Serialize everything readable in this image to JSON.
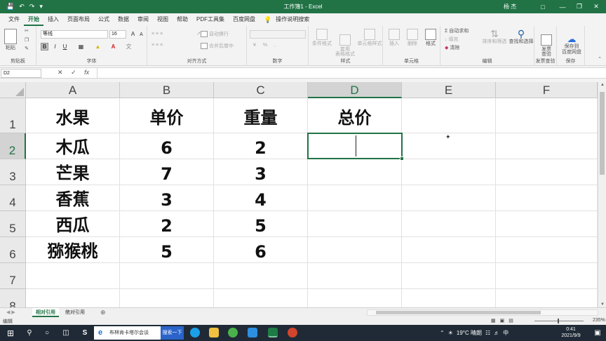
{
  "window": {
    "title": "工作簿1 - Excel",
    "user": "杨 杰",
    "controls": [
      "restore-ribbon",
      "minimize",
      "maximize",
      "close"
    ]
  },
  "quick_access": {
    "save": "save-icon",
    "undo": "undo-icon",
    "redo": "redo-icon",
    "customize": "customize-icon"
  },
  "tabs": [
    "文件",
    "开始",
    "插入",
    "页面布局",
    "公式",
    "数据",
    "审阅",
    "视图",
    "帮助",
    "PDF工具集",
    "百度网盘",
    "操作说明搜索"
  ],
  "active_tab": "开始",
  "ribbon": {
    "clipboard": {
      "paste": "粘贴",
      "label": "剪贴板"
    },
    "font": {
      "name": "等线",
      "size": "16",
      "bold": "B",
      "italic": "I",
      "underline": "U",
      "label": "字体",
      "grow": "A",
      "shrink": "A"
    },
    "alignment": {
      "wrap": "自动换行",
      "merge": "合并后居中",
      "label": "对齐方式"
    },
    "number": {
      "label": "数字",
      "percent": "%",
      "comma": ","
    },
    "styles": {
      "conditional": "条件格式",
      "table": "套用\n表格格式",
      "cell": "单元格样式",
      "label": "样式"
    },
    "cells": {
      "insert": "插入",
      "delete": "删除",
      "format": "格式",
      "label": "单元格"
    },
    "editing": {
      "autosum": "自动求和",
      "fill": "填充",
      "clear": "清除",
      "sort": "排序和筛选",
      "find": "查找和选择",
      "label": "编辑"
    },
    "invoice": {
      "button": "发票\n查验",
      "label": "发票查验"
    },
    "save_group": {
      "button": "保存到\n百度网盘",
      "label": "保存"
    }
  },
  "formula_bar": {
    "name_box": "D2",
    "value": "",
    "cancel": "✕",
    "enter": "✓",
    "fx": "fx"
  },
  "columns": [
    "A",
    "B",
    "C",
    "D",
    "E",
    "F"
  ],
  "selected_column": "D",
  "rows": [
    "1",
    "2",
    "3",
    "4",
    "5",
    "6",
    "7",
    "8"
  ],
  "selected_row": "2",
  "cells": [
    [
      "水果",
      "单价",
      "重量",
      "总价",
      "",
      ""
    ],
    [
      "木瓜",
      "6",
      "2",
      "",
      "",
      ""
    ],
    [
      "芒果",
      "7",
      "3",
      "",
      "",
      ""
    ],
    [
      "香蕉",
      "3",
      "4",
      "",
      "",
      ""
    ],
    [
      "西瓜",
      "2",
      "5",
      "",
      "",
      ""
    ],
    [
      "猕猴桃",
      "5",
      "6",
      "",
      "",
      ""
    ],
    [
      "",
      "",
      "",
      "",
      "",
      ""
    ],
    [
      "",
      "",
      "",
      "",
      "",
      ""
    ]
  ],
  "sheets": [
    "相对引用",
    "绝对引用"
  ],
  "active_sheet": "相对引用",
  "status": {
    "mode": "编辑",
    "zoom": "235%"
  },
  "taskbar": {
    "search_text": "布林肯卡塔尔会谈",
    "search_button": "搜索一下",
    "weather": "19°C 晴朗",
    "ime": "中",
    "time": "0:41",
    "date": "2021/9/9"
  }
}
